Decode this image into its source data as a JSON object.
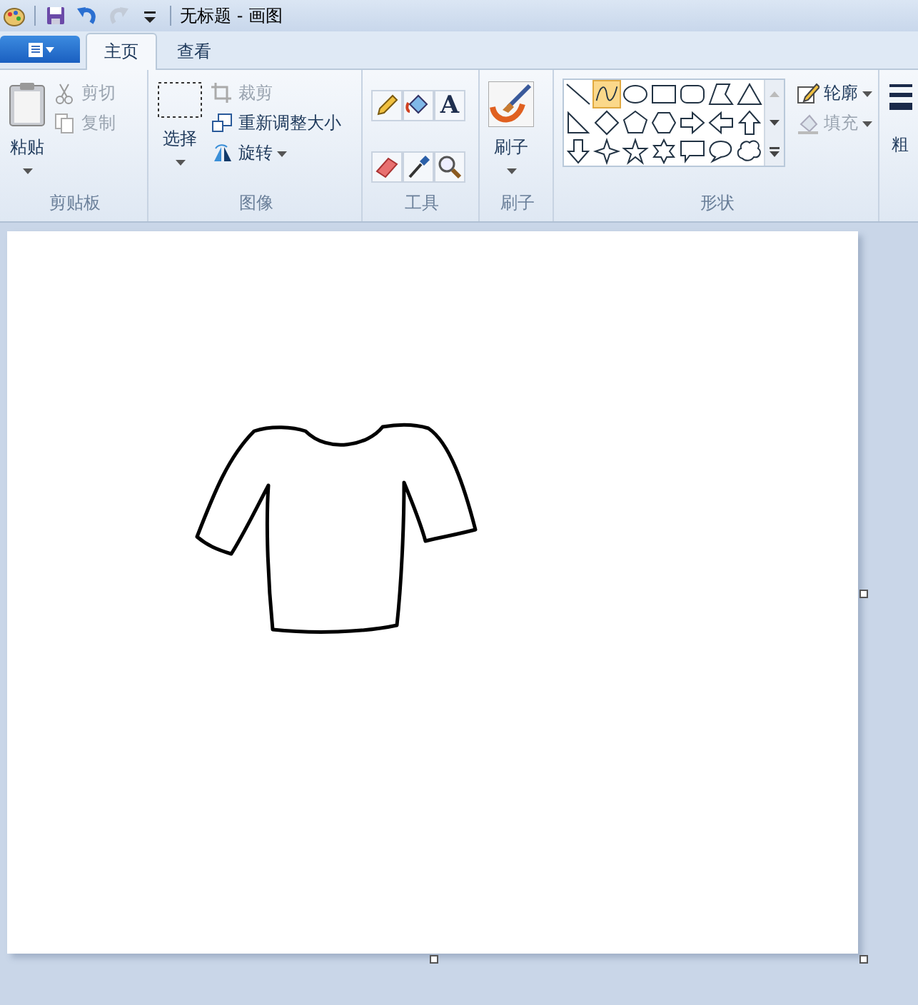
{
  "window": {
    "title": "无标题 - 画图"
  },
  "quick_access": [
    {
      "kind": "app",
      "disabled": false
    },
    {
      "kind": "save",
      "disabled": false
    },
    {
      "kind": "undo",
      "disabled": false
    },
    {
      "kind": "redo",
      "disabled": true
    },
    {
      "kind": "customize",
      "disabled": false
    }
  ],
  "tabs": [
    {
      "label": "主页",
      "selected": true
    },
    {
      "label": "查看",
      "selected": false
    }
  ],
  "clipboard": {
    "label": "剪贴板",
    "paste": "粘贴",
    "items": [
      {
        "kind": "cut",
        "label": "剪切",
        "disabled": true
      },
      {
        "kind": "copy",
        "label": "复制",
        "disabled": true
      }
    ]
  },
  "image": {
    "label": "图像",
    "select": "选择",
    "items": [
      {
        "kind": "crop",
        "label": "裁剪",
        "disabled": true
      },
      {
        "kind": "resize",
        "label": "重新调整大小",
        "disabled": false
      },
      {
        "kind": "rotate",
        "label": "旋转",
        "disabled": false
      }
    ]
  },
  "tools": {
    "label": "工具",
    "items": [
      {
        "kind": "pencil"
      },
      {
        "kind": "fill"
      },
      {
        "kind": "text",
        "glyph": "A"
      },
      {
        "kind": "eraser"
      },
      {
        "kind": "picker"
      },
      {
        "kind": "magnifier"
      }
    ]
  },
  "brush": {
    "label": "刷子",
    "button": "刷子"
  },
  "shapes": {
    "label": "形状",
    "items": [
      {
        "kind": "line",
        "selected": false
      },
      {
        "kind": "curve",
        "selected": true
      },
      {
        "kind": "oval",
        "selected": false
      },
      {
        "kind": "rect",
        "selected": false
      },
      {
        "kind": "roundrect",
        "selected": false
      },
      {
        "kind": "polygon",
        "selected": false
      },
      {
        "kind": "triangle",
        "selected": false
      },
      {
        "kind": "right-triangle",
        "selected": false
      },
      {
        "kind": "diamond",
        "selected": false
      },
      {
        "kind": "pentagon",
        "selected": false
      },
      {
        "kind": "hexagon",
        "selected": false
      },
      {
        "kind": "arrow-right",
        "selected": false
      },
      {
        "kind": "arrow-left",
        "selected": false
      },
      {
        "kind": "arrow-up",
        "selected": false
      },
      {
        "kind": "arrow-down",
        "selected": false
      },
      {
        "kind": "star4",
        "selected": false
      },
      {
        "kind": "star5",
        "selected": false
      },
      {
        "kind": "star6",
        "selected": false
      },
      {
        "kind": "callout-rect",
        "selected": false
      },
      {
        "kind": "callout-oval",
        "selected": false
      },
      {
        "kind": "callout-cloud",
        "selected": false
      }
    ],
    "options": [
      {
        "kind": "outline",
        "label": "轮廓",
        "disabled": false
      },
      {
        "kind": "fill",
        "label": "填充",
        "disabled": true
      }
    ]
  },
  "size": {
    "label": "粗"
  }
}
